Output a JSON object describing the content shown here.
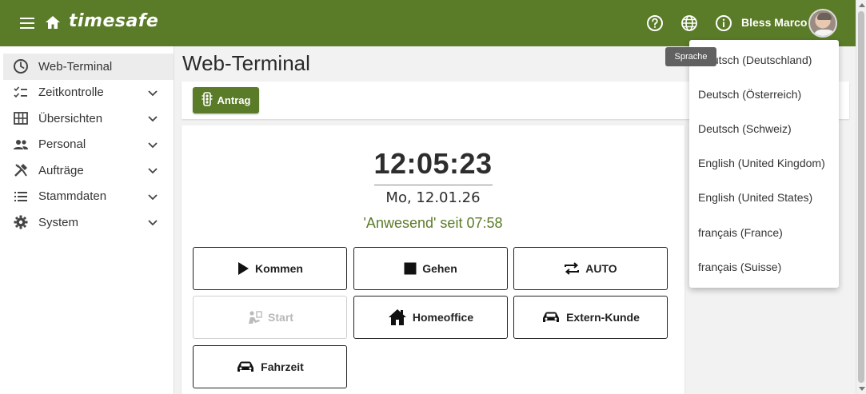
{
  "header": {
    "brand": "timesafe",
    "username": "Bless Marco",
    "icons": [
      "menu-icon",
      "home-icon",
      "help-icon",
      "globe-icon",
      "info-icon"
    ]
  },
  "tooltip": {
    "text": "Sprache"
  },
  "sidebar": {
    "items": [
      {
        "label": "Web-Terminal",
        "icon": "clock-icon",
        "active": true
      },
      {
        "label": "Zeitkontrolle",
        "icon": "checklist-icon"
      },
      {
        "label": "Übersichten",
        "icon": "grid-icon"
      },
      {
        "label": "Personal",
        "icon": "people-icon"
      },
      {
        "label": "Aufträge",
        "icon": "tools-icon"
      },
      {
        "label": "Stammdaten",
        "icon": "list-icon"
      },
      {
        "label": "System",
        "icon": "gear-icon"
      }
    ]
  },
  "main": {
    "title": "Web-Terminal",
    "antrag_label": "Antrag",
    "clock": "12:05:23",
    "date": "Mo, 12.01.26",
    "status": "'Anwesend' seit 07:58",
    "buttons": {
      "kommen": "Kommen",
      "gehen": "Gehen",
      "auto": "AUTO",
      "start": "Start",
      "homeoffice": "Homeoffice",
      "extern": "Extern-Kunde",
      "fahrzeit": "Fahrzeit"
    }
  },
  "language_menu": {
    "items": [
      "Deutsch (Deutschland)",
      "Deutsch (Österreich)",
      "Deutsch (Schweiz)",
      "English (United Kingdom)",
      "English (United States)",
      "français (France)",
      "français (Suisse)"
    ]
  },
  "colors": {
    "brand_green": "#5a7b28",
    "status_green": "#5a7b28",
    "tooltip_bg": "#616161"
  }
}
